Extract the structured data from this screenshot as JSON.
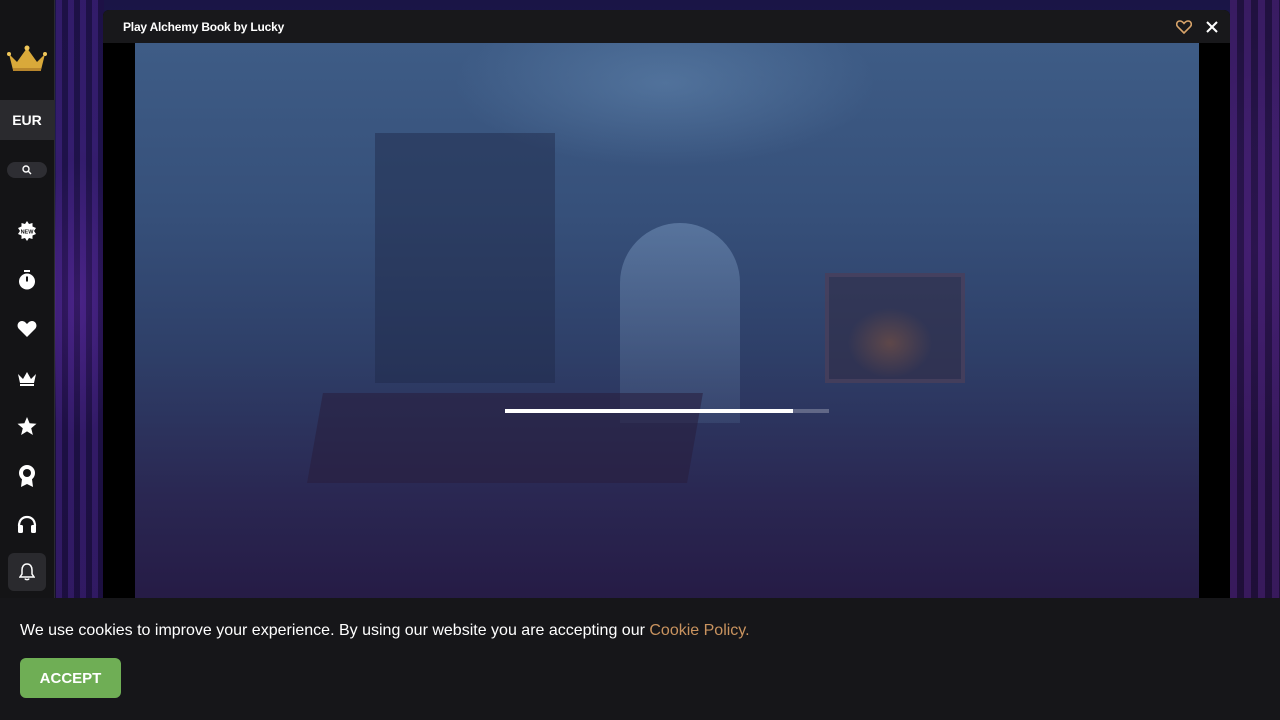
{
  "sidebar": {
    "currency": "EUR",
    "nav_icons": [
      "new-icon",
      "timer-icon",
      "heart-icon",
      "crown-icon",
      "star-icon",
      "award-icon",
      "headset-icon",
      "bell-icon"
    ]
  },
  "modal": {
    "title": "Play Alchemy Book by Lucky",
    "favorite_color": "#d7a36a"
  },
  "game": {
    "loading_progress": 0.89
  },
  "cookie_banner": {
    "text": "We use cookies to improve your experience. By using our website you are accepting our ",
    "link_text": "Cookie Policy.",
    "accept_label": "ACCEPT",
    "link_color": "#c9935f",
    "accept_color": "#6fae55"
  }
}
